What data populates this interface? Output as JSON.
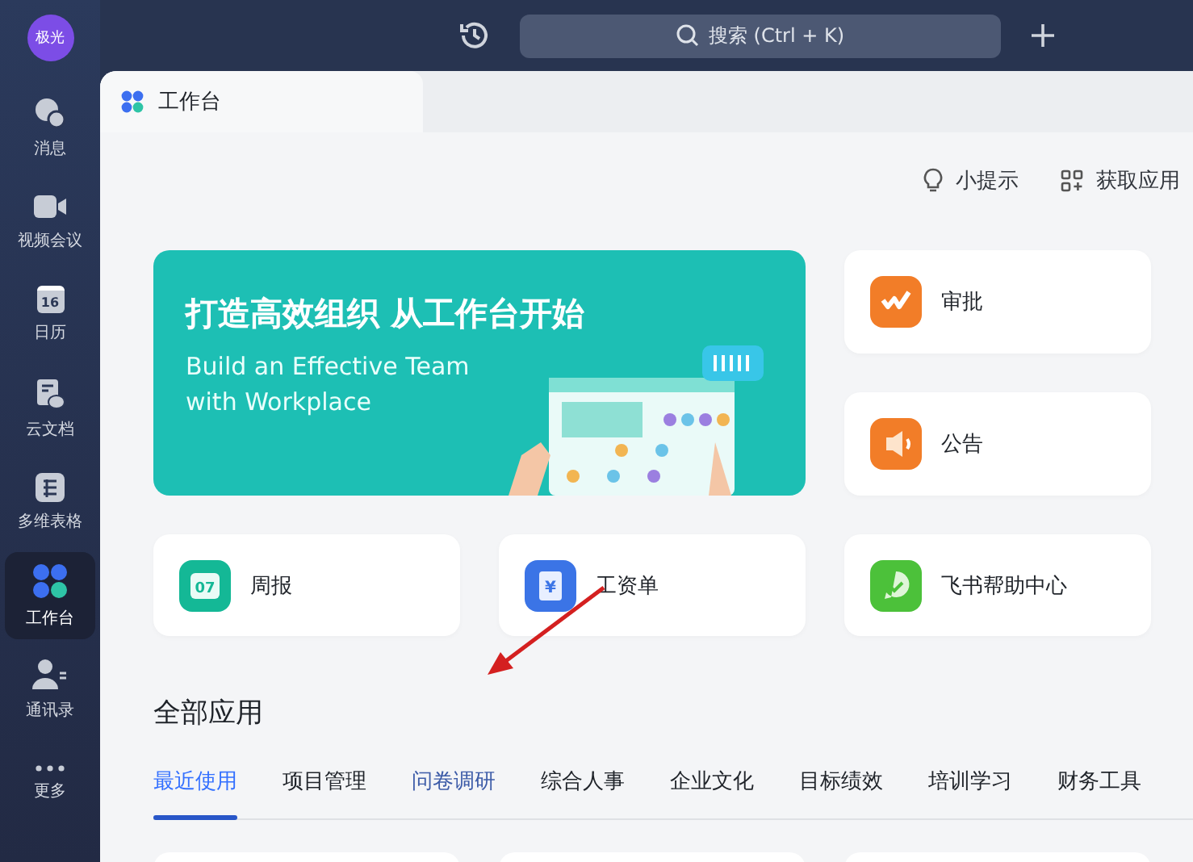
{
  "user": {
    "avatar_text": "极光"
  },
  "sidebar": {
    "items": [
      {
        "label": "消息",
        "kind": "chat",
        "selected": false
      },
      {
        "label": "视频会议",
        "kind": "video",
        "selected": false
      },
      {
        "label": "日历",
        "kind": "calendar",
        "icon_text": "16",
        "selected": false
      },
      {
        "label": "云文档",
        "kind": "docs",
        "selected": false
      },
      {
        "label": "多维表格",
        "kind": "table",
        "selected": false
      },
      {
        "label": "工作台",
        "kind": "workplace",
        "selected": true
      },
      {
        "label": "通讯录",
        "kind": "contacts",
        "selected": false
      },
      {
        "label": "更多",
        "kind": "more",
        "selected": false
      }
    ]
  },
  "topbar": {
    "search": {
      "placeholder": "搜索 (Ctrl + K)"
    }
  },
  "tab": {
    "title": "工作台"
  },
  "toolbar": [
    {
      "label": "小提示",
      "kind": "bulb"
    },
    {
      "label": "获取应用",
      "kind": "apps"
    }
  ],
  "banner": {
    "title": "打造高效组织 从工作台开始",
    "subtitle": "Build an Effective Team with Workplace"
  },
  "shortcuts": [
    {
      "label": "审批",
      "kind": "approval",
      "color": "#f27d28"
    },
    {
      "label": "公告",
      "kind": "announce",
      "color": "#f27d28"
    },
    {
      "label": "周报",
      "kind": "weekly",
      "color": "#14b896",
      "icon_text": "07"
    },
    {
      "label": "工资单",
      "kind": "payroll",
      "color": "#3b74e6",
      "icon_text": "¥"
    },
    {
      "label": "飞书帮助中心",
      "kind": "help",
      "color": "#4cc13a"
    }
  ],
  "all_apps": {
    "title": "全部应用",
    "tabs": [
      {
        "label": "最近使用",
        "selected": true,
        "hovered": false
      },
      {
        "label": "项目管理",
        "selected": false,
        "hovered": false
      },
      {
        "label": "问卷调研",
        "selected": false,
        "hovered": true
      },
      {
        "label": "综合人事",
        "selected": false,
        "hovered": false
      },
      {
        "label": "企业文化",
        "selected": false,
        "hovered": false
      },
      {
        "label": "目标绩效",
        "selected": false,
        "hovered": false
      },
      {
        "label": "培训学习",
        "selected": false,
        "hovered": false
      },
      {
        "label": "财务工具",
        "selected": false,
        "hovered": false
      }
    ]
  }
}
